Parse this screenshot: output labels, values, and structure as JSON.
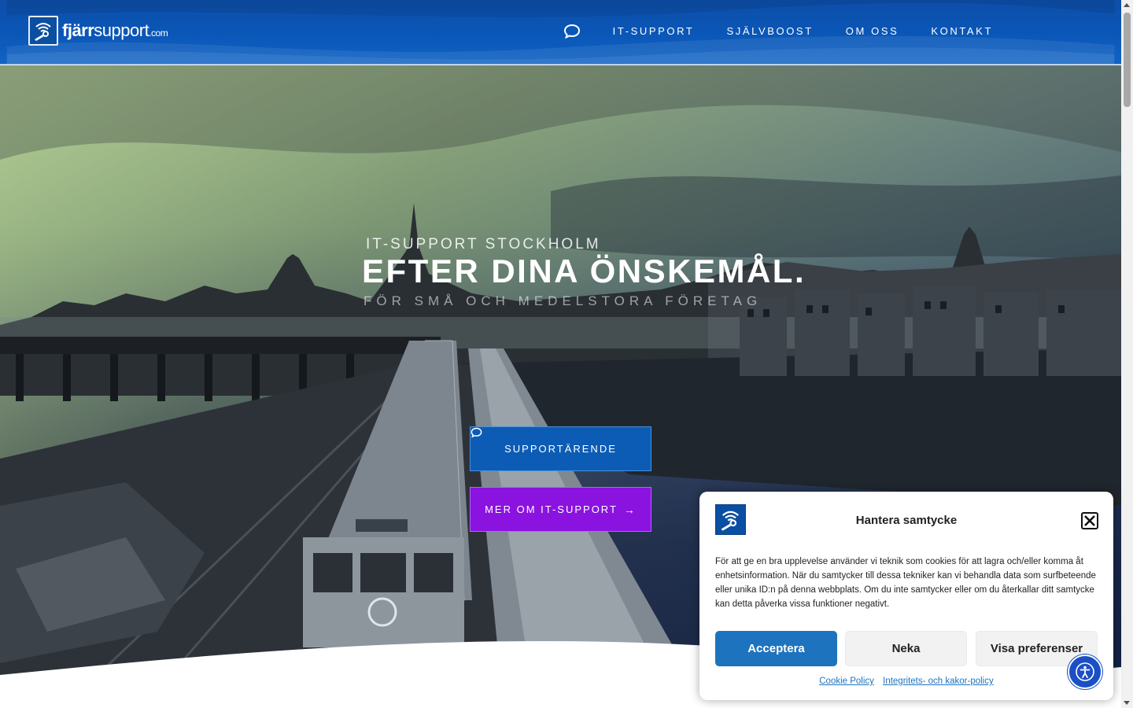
{
  "header": {
    "logo": {
      "main": "fjärr",
      "rest": "support",
      "suffix": ".com"
    },
    "nav": [
      "IT-SUPPORT",
      "SJÄLVBOOST",
      "OM OSS",
      "KONTAKT"
    ],
    "chat_icon": "chat-bubble-icon"
  },
  "hero": {
    "subtitle": "IT-SUPPORT STOCKHOLM",
    "title": "EFTER DINA ÖNSKEMÅL.",
    "tagline": "FÖR SMÅ OCH MEDELSTORA FÖRETAG",
    "support_button": "SUPPORTÄRENDE",
    "more_button": "MER OM IT-SUPPORT",
    "more_arrow": "→"
  },
  "cookie": {
    "title": "Hantera samtycke",
    "body": "För att ge en bra upplevelse använder vi teknik som cookies för att lagra och/eller komma åt enhetsinformation. När du samtycker till dessa tekniker kan vi behandla data som surfbeteende eller unika ID:n på denna webbplats. Om du inte samtycker eller om du återkallar ditt samtycke kan detta påverka vissa funktioner negativt.",
    "accept": "Acceptera",
    "deny": "Neka",
    "prefs": "Visa preferenser",
    "links": [
      "Cookie Policy",
      "Integritets- och kakor-policy"
    ]
  },
  "colors": {
    "header_blue": "#0a57b8",
    "support_button": "#0c5cb5",
    "more_button": "#8a13e0",
    "accept_button": "#1e73be",
    "accessibility_button": "#1b4fc4"
  }
}
